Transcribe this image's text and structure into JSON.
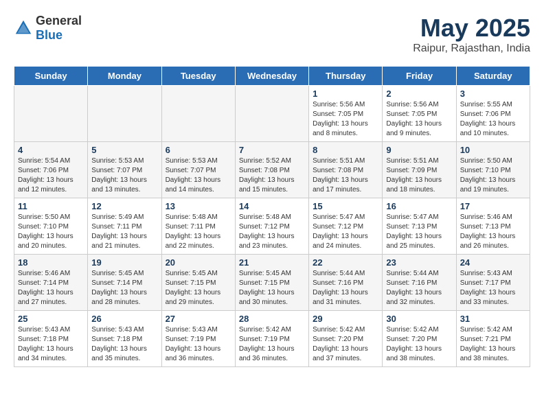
{
  "header": {
    "logo_general": "General",
    "logo_blue": "Blue",
    "title": "May 2025",
    "subtitle": "Raipur, Rajasthan, India"
  },
  "weekdays": [
    "Sunday",
    "Monday",
    "Tuesday",
    "Wednesday",
    "Thursday",
    "Friday",
    "Saturday"
  ],
  "weeks": [
    {
      "row_class": "row-week-1",
      "days": [
        {
          "num": "",
          "empty": true
        },
        {
          "num": "",
          "empty": true
        },
        {
          "num": "",
          "empty": true
        },
        {
          "num": "",
          "empty": true
        },
        {
          "num": "1",
          "sunrise": "5:56 AM",
          "sunset": "7:05 PM",
          "daylight": "13 hours and 8 minutes."
        },
        {
          "num": "2",
          "sunrise": "5:56 AM",
          "sunset": "7:05 PM",
          "daylight": "13 hours and 9 minutes."
        },
        {
          "num": "3",
          "sunrise": "5:55 AM",
          "sunset": "7:06 PM",
          "daylight": "13 hours and 10 minutes."
        }
      ]
    },
    {
      "row_class": "row-week-2",
      "days": [
        {
          "num": "4",
          "sunrise": "5:54 AM",
          "sunset": "7:06 PM",
          "daylight": "13 hours and 12 minutes."
        },
        {
          "num": "5",
          "sunrise": "5:53 AM",
          "sunset": "7:07 PM",
          "daylight": "13 hours and 13 minutes."
        },
        {
          "num": "6",
          "sunrise": "5:53 AM",
          "sunset": "7:07 PM",
          "daylight": "13 hours and 14 minutes."
        },
        {
          "num": "7",
          "sunrise": "5:52 AM",
          "sunset": "7:08 PM",
          "daylight": "13 hours and 15 minutes."
        },
        {
          "num": "8",
          "sunrise": "5:51 AM",
          "sunset": "7:08 PM",
          "daylight": "13 hours and 17 minutes."
        },
        {
          "num": "9",
          "sunrise": "5:51 AM",
          "sunset": "7:09 PM",
          "daylight": "13 hours and 18 minutes."
        },
        {
          "num": "10",
          "sunrise": "5:50 AM",
          "sunset": "7:10 PM",
          "daylight": "13 hours and 19 minutes."
        }
      ]
    },
    {
      "row_class": "row-week-3",
      "days": [
        {
          "num": "11",
          "sunrise": "5:50 AM",
          "sunset": "7:10 PM",
          "daylight": "13 hours and 20 minutes."
        },
        {
          "num": "12",
          "sunrise": "5:49 AM",
          "sunset": "7:11 PM",
          "daylight": "13 hours and 21 minutes."
        },
        {
          "num": "13",
          "sunrise": "5:48 AM",
          "sunset": "7:11 PM",
          "daylight": "13 hours and 22 minutes."
        },
        {
          "num": "14",
          "sunrise": "5:48 AM",
          "sunset": "7:12 PM",
          "daylight": "13 hours and 23 minutes."
        },
        {
          "num": "15",
          "sunrise": "5:47 AM",
          "sunset": "7:12 PM",
          "daylight": "13 hours and 24 minutes."
        },
        {
          "num": "16",
          "sunrise": "5:47 AM",
          "sunset": "7:13 PM",
          "daylight": "13 hours and 25 minutes."
        },
        {
          "num": "17",
          "sunrise": "5:46 AM",
          "sunset": "7:13 PM",
          "daylight": "13 hours and 26 minutes."
        }
      ]
    },
    {
      "row_class": "row-week-4",
      "days": [
        {
          "num": "18",
          "sunrise": "5:46 AM",
          "sunset": "7:14 PM",
          "daylight": "13 hours and 27 minutes."
        },
        {
          "num": "19",
          "sunrise": "5:45 AM",
          "sunset": "7:14 PM",
          "daylight": "13 hours and 28 minutes."
        },
        {
          "num": "20",
          "sunrise": "5:45 AM",
          "sunset": "7:15 PM",
          "daylight": "13 hours and 29 minutes."
        },
        {
          "num": "21",
          "sunrise": "5:45 AM",
          "sunset": "7:15 PM",
          "daylight": "13 hours and 30 minutes."
        },
        {
          "num": "22",
          "sunrise": "5:44 AM",
          "sunset": "7:16 PM",
          "daylight": "13 hours and 31 minutes."
        },
        {
          "num": "23",
          "sunrise": "5:44 AM",
          "sunset": "7:16 PM",
          "daylight": "13 hours and 32 minutes."
        },
        {
          "num": "24",
          "sunrise": "5:43 AM",
          "sunset": "7:17 PM",
          "daylight": "13 hours and 33 minutes."
        }
      ]
    },
    {
      "row_class": "row-week-5",
      "days": [
        {
          "num": "25",
          "sunrise": "5:43 AM",
          "sunset": "7:18 PM",
          "daylight": "13 hours and 34 minutes."
        },
        {
          "num": "26",
          "sunrise": "5:43 AM",
          "sunset": "7:18 PM",
          "daylight": "13 hours and 35 minutes."
        },
        {
          "num": "27",
          "sunrise": "5:43 AM",
          "sunset": "7:19 PM",
          "daylight": "13 hours and 36 minutes."
        },
        {
          "num": "28",
          "sunrise": "5:42 AM",
          "sunset": "7:19 PM",
          "daylight": "13 hours and 36 minutes."
        },
        {
          "num": "29",
          "sunrise": "5:42 AM",
          "sunset": "7:20 PM",
          "daylight": "13 hours and 37 minutes."
        },
        {
          "num": "30",
          "sunrise": "5:42 AM",
          "sunset": "7:20 PM",
          "daylight": "13 hours and 38 minutes."
        },
        {
          "num": "31",
          "sunrise": "5:42 AM",
          "sunset": "7:21 PM",
          "daylight": "13 hours and 38 minutes."
        }
      ]
    }
  ],
  "labels": {
    "sunrise": "Sunrise:",
    "sunset": "Sunset:",
    "daylight": "Daylight:"
  }
}
